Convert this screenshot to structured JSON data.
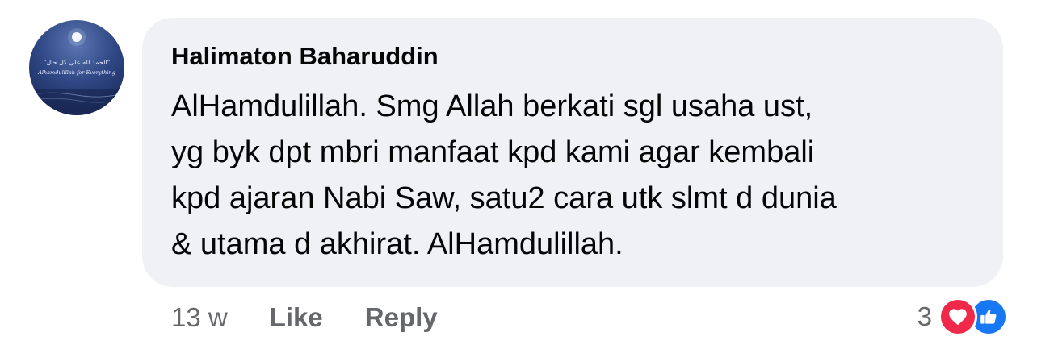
{
  "comment": {
    "author": "Halimaton Baharuddin",
    "text_lines": [
      "AlHamdulillah. Smg Allah berkati sgl usaha ust,",
      "yg byk dpt mbri manfaat kpd kami agar kembali",
      "kpd ajaran Nabi Saw, satu2 cara utk slmt d dunia",
      "& utama d akhirat. AlHamdulillah."
    ],
    "avatar": {
      "arabic_text": "\"الحمد لله على كل حال\"",
      "caption": "Alhamdulillah for Everything"
    }
  },
  "actions": {
    "time": "13 w",
    "like_label": "Like",
    "reply_label": "Reply"
  },
  "reactions": {
    "count": "3",
    "icons": [
      "heart-icon",
      "thumbs-up-icon"
    ],
    "colors": {
      "heart": "#f0284a",
      "like": "#1877f2"
    }
  }
}
